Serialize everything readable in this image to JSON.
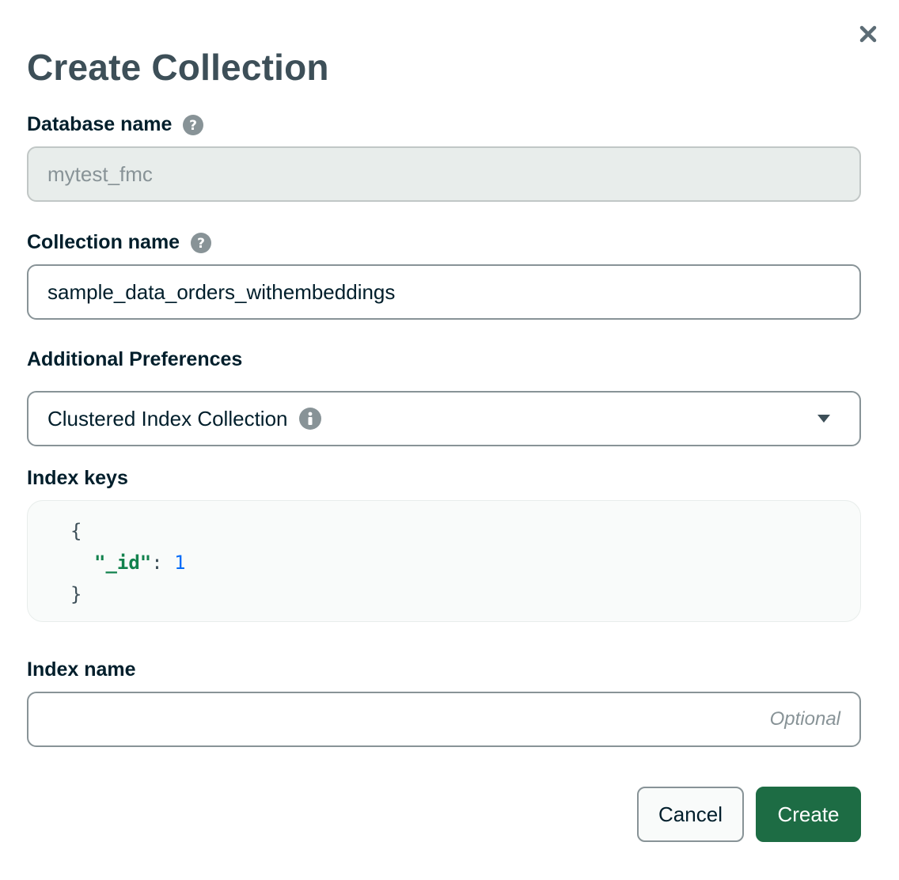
{
  "dialog": {
    "title": "Create Collection",
    "close_icon": "close-icon"
  },
  "database": {
    "label": "Database name",
    "value": "mytest_fmc",
    "help_icon": "question-circle-icon"
  },
  "collection": {
    "label": "Collection name",
    "value": "sample_data_orders_withembeddings",
    "help_icon": "question-circle-icon"
  },
  "preferences": {
    "label": "Additional Preferences",
    "selected": "Clustered Index Collection",
    "info_icon": "info-circle-icon",
    "dropdown_icon": "caret-down-icon"
  },
  "index_keys": {
    "label": "Index keys",
    "open_brace": "{",
    "key": "\"_id\"",
    "colon": ": ",
    "value": "1",
    "close_brace": "}"
  },
  "index_name": {
    "label": "Index name",
    "placeholder": "Optional",
    "value": ""
  },
  "buttons": {
    "cancel": "Cancel",
    "create": "Create"
  },
  "colors": {
    "primary": "#1d6c44",
    "title": "#3d4f58",
    "code_key": "#12824d",
    "code_number": "#016bf8",
    "disabled_bg": "#e8edeb"
  }
}
